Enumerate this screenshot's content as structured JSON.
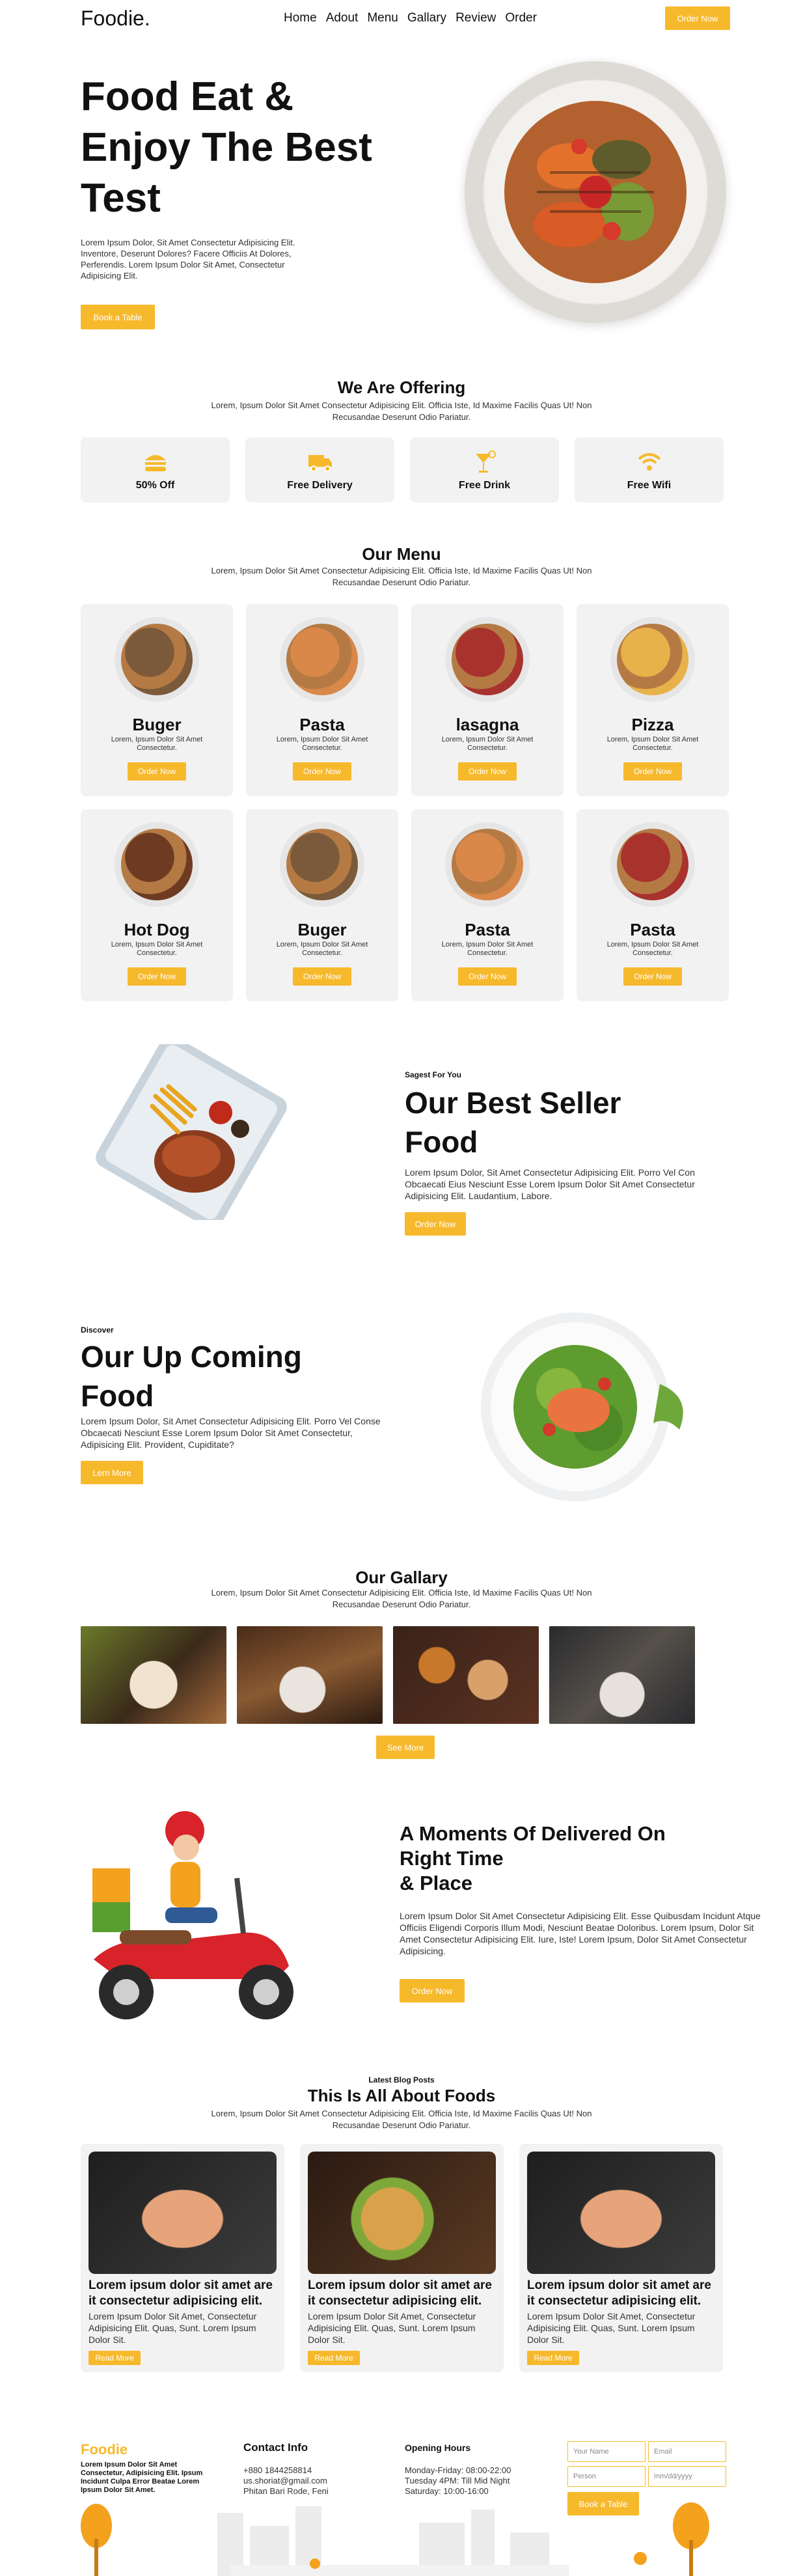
{
  "header": {
    "logo": "Foodie.",
    "nav": [
      "Home",
      "Adout",
      "Menu",
      "Gallary",
      "Review",
      "Order"
    ],
    "order_btn": "Order Now"
  },
  "hero": {
    "title_lines": [
      "Food Eat &",
      "Enjoy The Best",
      "Test"
    ],
    "text": "Lorem Ipsum Dolor, Sit Amet Consectetur Adipisicing Elit. Inventore, Deserunt Dolores? Facere Officiis At Dolores, Perferendis. Lorem Ipsum Dolor Sit Amet, Consectetur Adipisicing Elit.",
    "button": "Book a Table"
  },
  "offering": {
    "title": "We Are Offering",
    "sub": "Lorem, Ipsum Dolor Sit Amet Consectetur Adipisicing Elit. Officia Iste, Id Maxime Facilis Quas Ut! Non Recusandae Deserunt Odio Pariatur.",
    "items": [
      {
        "label": "50% Off",
        "icon": "burger-icon"
      },
      {
        "label": "Free Delivery",
        "icon": "truck-icon"
      },
      {
        "label": "Free Drink",
        "icon": "cocktail-icon"
      },
      {
        "label": "Free Wifi",
        "icon": "wifi-icon"
      }
    ]
  },
  "menu": {
    "title": "Our Menu",
    "sub": "Lorem, Ipsum Dolor Sit Amet Consectetur Adipisicing Elit. Officia Iste, Id Maxime Facilis Quas Ut! Non Recusandae Deserunt Odio Pariatur.",
    "items": [
      {
        "name": "Buger",
        "desc": "Lorem, Ipsum Dolor Sit Amet Consectetur.",
        "btn": "Order Now",
        "color": "#7a5a3a"
      },
      {
        "name": "Pasta",
        "desc": "Lorem, Ipsum Dolor Sit Amet Consectetur.",
        "btn": "Order Now",
        "color": "#d9884a"
      },
      {
        "name": "lasagna",
        "desc": "Lorem, Ipsum Dolor Sit Amet Consectetur.",
        "btn": "Order Now",
        "color": "#a8322e"
      },
      {
        "name": "Pizza",
        "desc": "Lorem, Ipsum Dolor Sit Amet Consectetur.",
        "btn": "Order Now",
        "color": "#e8b24a"
      },
      {
        "name": "Hot Dog",
        "desc": "Lorem, Ipsum Dolor Sit Amet Consectetur.",
        "btn": "Order Now",
        "color": "#6e3b22"
      },
      {
        "name": "Buger",
        "desc": "Lorem, Ipsum Dolor Sit Amet Consectetur.",
        "btn": "Order Now",
        "color": "#7a5a3a"
      },
      {
        "name": "Pasta",
        "desc": "Lorem, Ipsum Dolor Sit Amet Consectetur.",
        "btn": "Order Now",
        "color": "#d9884a"
      },
      {
        "name": "Pasta",
        "desc": "Lorem, Ipsum Dolor Sit Amet Consectetur.",
        "btn": "Order Now",
        "color": "#a8322e"
      }
    ]
  },
  "best_seller": {
    "tag": "Sagest For You",
    "title_lines": [
      "Our Best Seller",
      "Food"
    ],
    "text": "Lorem Ipsum Dolor, Sit Amet Consectetur Adipisicing Elit. Porro Vel Con Obcaecati Eius Nesciunt Esse Lorem Ipsum Dolor Sit Amet Consectetur Adipisicing Elit. Laudantium, Labore.",
    "button": "Order Now"
  },
  "upcoming": {
    "tag": "Discover",
    "title_lines": [
      "Our Up Coming",
      "Food"
    ],
    "text": "Lorem Ipsum Dolor, Sit Amet Consectetur Adipisicing Elit. Porro Vel Conse Obcaecati Nesciunt Esse Lorem Ipsum Dolor Sit Amet Consectetur, Adipisicing Elit. Provident, Cupiditate?",
    "button": "Lern More"
  },
  "gallery": {
    "title": "Our Gallary",
    "sub": "Lorem, Ipsum Dolor Sit Amet Consectetur Adipisicing Elit. Officia Iste, Id Maxime Facilis Quas Ut! Non Recusandae Deserunt Odio Pariatur.",
    "button": "See More"
  },
  "delivery": {
    "title_lines": [
      "A Moments Of Delivered On",
      "Right Time",
      "& Place"
    ],
    "text": "Lorem Ipsum Dolor Sit Amet Consectetur Adipisicing Elit. Esse Quibusdam Incidunt Atque Officiis Eligendi Corporis Illum Modi, Nesciunt Beatae Doloribus. Lorem Ipsum, Dolor Sit Amet Consectetur Adipisicing Elit. Iure, Iste! Lorem Ipsum, Dolor Sit Amet Consectetur Adipisicing.",
    "button": "Order Now"
  },
  "blog": {
    "tag": "Latest Blog Posts",
    "title": "This Is All About Foods",
    "sub": "Lorem, Ipsum Dolor Sit Amet Consectetur Adipisicing Elit. Officia Iste, Id Maxime Facilis Quas Ut! Non Recusandae Deserunt Odio Pariatur.",
    "posts": [
      {
        "title": "Lorem ipsum dolor sit amet are it consectetur adipisicing elit.",
        "desc": "Lorem Ipsum Dolor Sit Amet, Consectetur Adipisicing Elit. Quas, Sunt. Lorem Ipsum Dolor Sit.",
        "btn": "Read More"
      },
      {
        "title": "Lorem ipsum dolor sit amet are it consectetur adipisicing elit.",
        "desc": "Lorem Ipsum Dolor Sit Amet, Consectetur Adipisicing Elit. Quas, Sunt. Lorem Ipsum Dolor Sit.",
        "btn": "Read More"
      },
      {
        "title": "Lorem ipsum dolor sit amet are it consectetur adipisicing elit.",
        "desc": "Lorem Ipsum Dolor Sit Amet, Consectetur Adipisicing Elit. Quas, Sunt. Lorem Ipsum Dolor Sit.",
        "btn": "Read More"
      }
    ]
  },
  "footer": {
    "logo": "Foodie",
    "about": "Lorem Ipsum Dolor Sit Amet Consectetur, Adipisicing Elit. Ipsum Incidunt Culpa Error Beatae Lorem Ipsum Dolor Sit Amet.",
    "contact_title": "Contact Info",
    "contact_lines": [
      "+880 1844258814",
      "us.shoriat@gmail.com",
      "Phitan Bari Rode, Feni"
    ],
    "hours_title": "Opening Hours",
    "hours_lines": [
      "Monday-Friday: 08:00-22:00",
      "Tuesday 4PM: Till Mid Night",
      "Saturday: 10:00-16:00"
    ],
    "form": {
      "name_ph": "Your Name",
      "email_ph": "Email",
      "person_ph": "Person",
      "date_ph": "mm/dd/yyyy",
      "button": "Book a Table"
    }
  },
  "colors": {
    "accent": "#f7b92c",
    "card": "#f2f2f2"
  }
}
